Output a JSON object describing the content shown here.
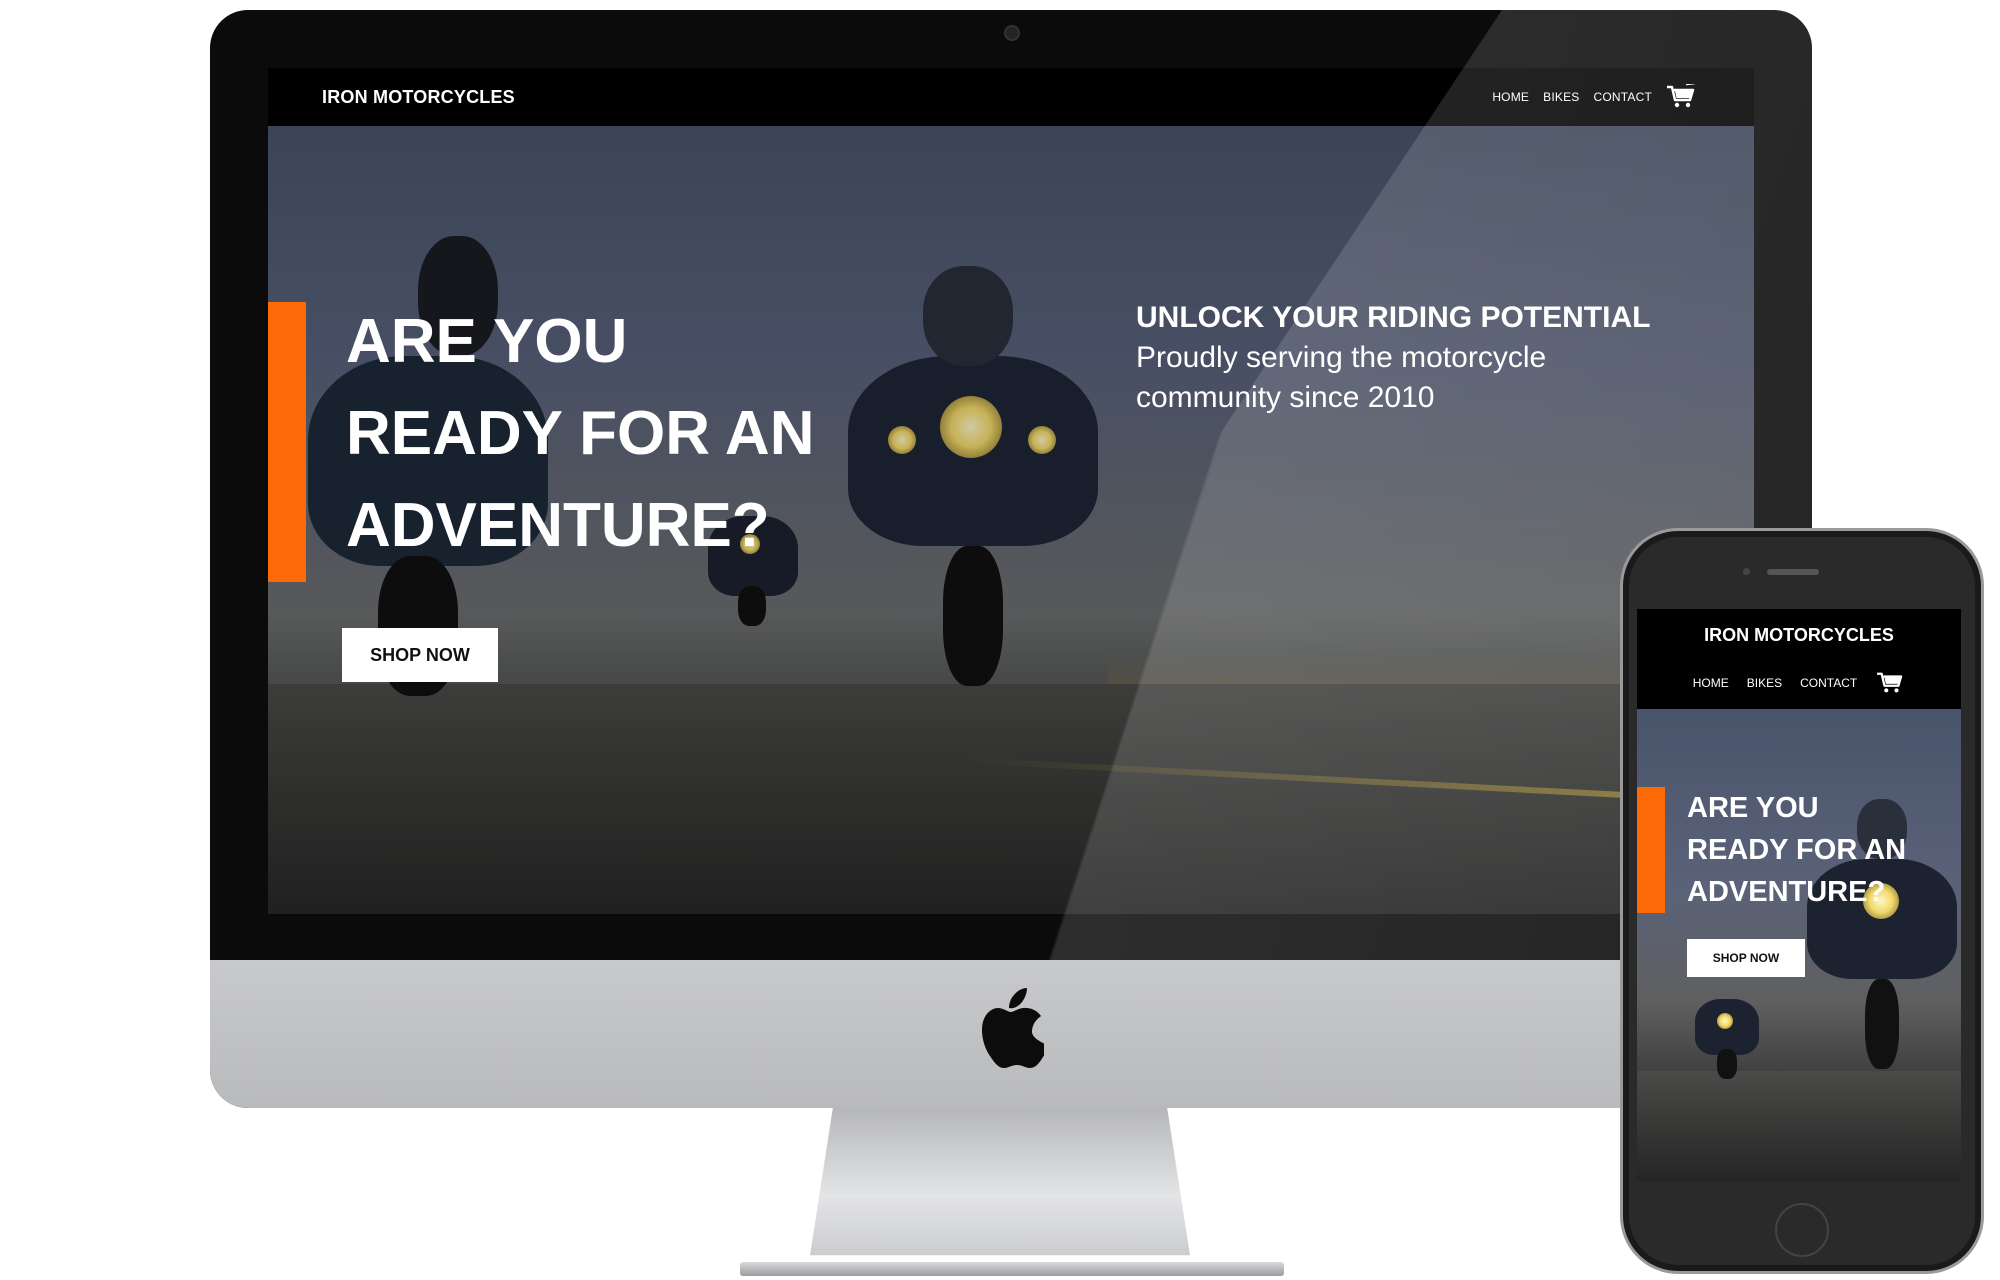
{
  "desktop": {
    "brand": "IRON MOTORCYCLES",
    "nav": {
      "home": "HOME",
      "bikes": "BIKES",
      "contact": "CONTACT"
    },
    "hero": {
      "headline": [
        "ARE YOU",
        "READY FOR AN",
        "ADVENTURE?"
      ],
      "cta": "SHOP NOW",
      "tagline_title": "UNLOCK YOUR RIDING POTENTIAL",
      "tagline_sub": "Proudly serving the motorcycle community since 2010"
    }
  },
  "mobile": {
    "brand": "IRON MOTORCYCLES",
    "nav": {
      "home": "HOME",
      "bikes": "BIKES",
      "contact": "CONTACT"
    },
    "hero": {
      "headline": [
        "ARE YOU",
        "READY FOR AN",
        "ADVENTURE?"
      ],
      "cta": "SHOP NOW"
    }
  },
  "colors": {
    "accent": "#ff6a08",
    "nav_bg": "#000000",
    "button_bg": "#ffffff"
  },
  "icons": {
    "cart": "shopping-cart-icon",
    "device_logo": "apple-logo"
  }
}
